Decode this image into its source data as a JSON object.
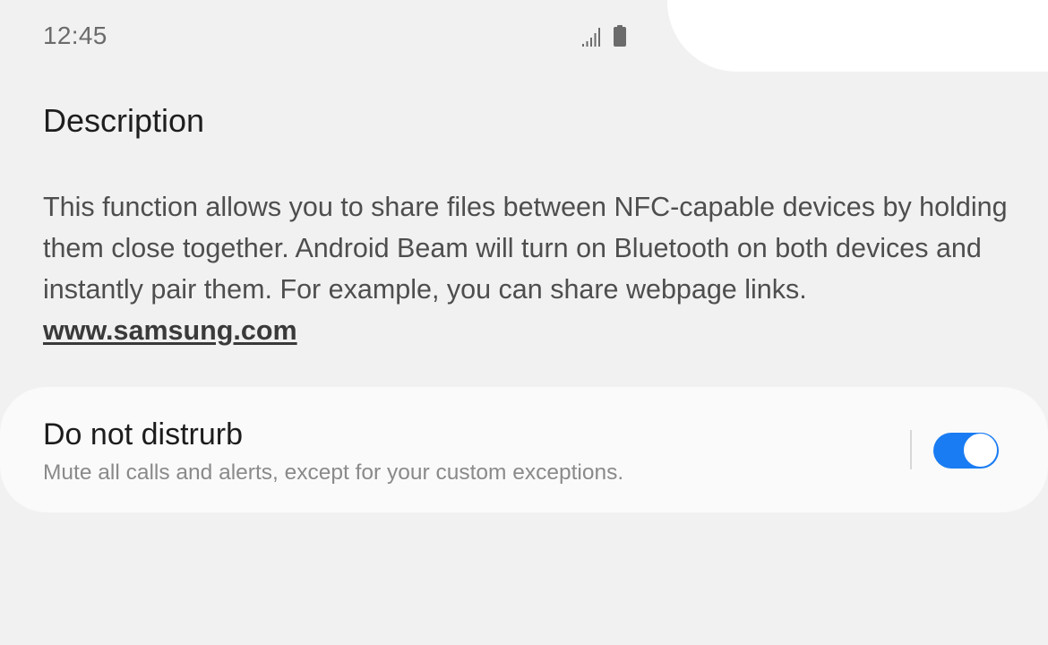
{
  "status_bar": {
    "time": "12:45",
    "icons": [
      "signal-icon",
      "battery-icon"
    ]
  },
  "description": {
    "heading": "Description",
    "body": "This function allows you to share files between NFC-capable devices by holding them close together. Android Beam will  turn on Bluetooth on both devices and instantly pair them. For example, you can share webpage links.",
    "link": "www.samsung.com"
  },
  "setting": {
    "title": "Do not distrurb",
    "subtitle": "Mute all calls and alerts, except for your custom exceptions.",
    "enabled": true
  },
  "colors": {
    "background": "#f1f1f1",
    "card": "#fafafa",
    "accent": "#1a7cf2"
  }
}
